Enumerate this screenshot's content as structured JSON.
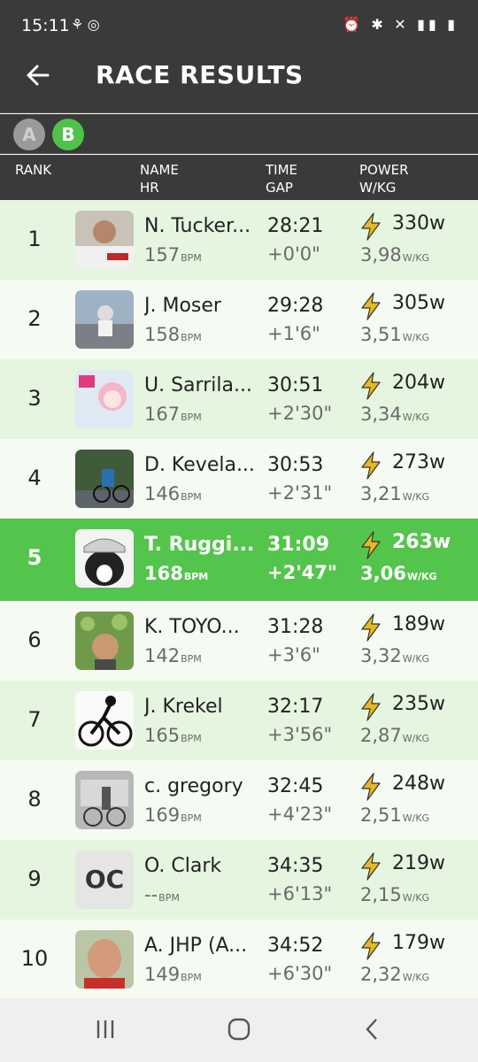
{
  "status": {
    "time": "15:11"
  },
  "header": {
    "title": "RACE RESULTS"
  },
  "categories": [
    {
      "label": "A",
      "active": false
    },
    {
      "label": "B",
      "active": true
    }
  ],
  "columns": {
    "rank": "RANK",
    "name": "NAME",
    "hr": "HR",
    "time": "TIME",
    "gap": "GAP",
    "power": "POWER",
    "wkg": "W/KG"
  },
  "units": {
    "bpm": "BPM",
    "wkg": "W/KG"
  },
  "colors": {
    "accent": "#53c54c",
    "bar": "#3a3a3a",
    "bolt": "#e9b91c"
  },
  "rows": [
    {
      "rank": "1",
      "name": "N. Tucker...",
      "hr": "157",
      "time": "28:21",
      "gap": "+0'0\"",
      "power": "330w",
      "wkg": "3,98"
    },
    {
      "rank": "2",
      "name": "J. Moser",
      "hr": "158",
      "time": "29:28",
      "gap": "+1'6\"",
      "power": "305w",
      "wkg": "3,51"
    },
    {
      "rank": "3",
      "name": "U. Sarrila...",
      "hr": "167",
      "time": "30:51",
      "gap": "+2'30\"",
      "power": "204w",
      "wkg": "3,34"
    },
    {
      "rank": "4",
      "name": "D. Kevela...",
      "hr": "146",
      "time": "30:53",
      "gap": "+2'31\"",
      "power": "273w",
      "wkg": "3,21"
    },
    {
      "rank": "5",
      "name": "T. Ruggi...",
      "hr": "168",
      "time": "31:09",
      "gap": "+2'47\"",
      "power": "263w",
      "wkg": "3,06"
    },
    {
      "rank": "6",
      "name": "K. TOYO...",
      "hr": "142",
      "time": "31:28",
      "gap": "+3'6\"",
      "power": "189w",
      "wkg": "3,32"
    },
    {
      "rank": "7",
      "name": "J. Krekel",
      "hr": "165",
      "time": "32:17",
      "gap": "+3'56\"",
      "power": "235w",
      "wkg": "2,87"
    },
    {
      "rank": "8",
      "name": "c. gregory",
      "hr": "169",
      "time": "32:45",
      "gap": "+4'23\"",
      "power": "248w",
      "wkg": "2,51"
    },
    {
      "rank": "9",
      "name": "O. Clark",
      "hr": "--",
      "time": "34:35",
      "gap": "+6'13\"",
      "power": "219w",
      "wkg": "2,15",
      "initials": "OC"
    },
    {
      "rank": "10",
      "name": "A. JHP (A...",
      "hr": "149",
      "time": "34:52",
      "gap": "+6'30\"",
      "power": "179w",
      "wkg": "2,32"
    }
  ]
}
